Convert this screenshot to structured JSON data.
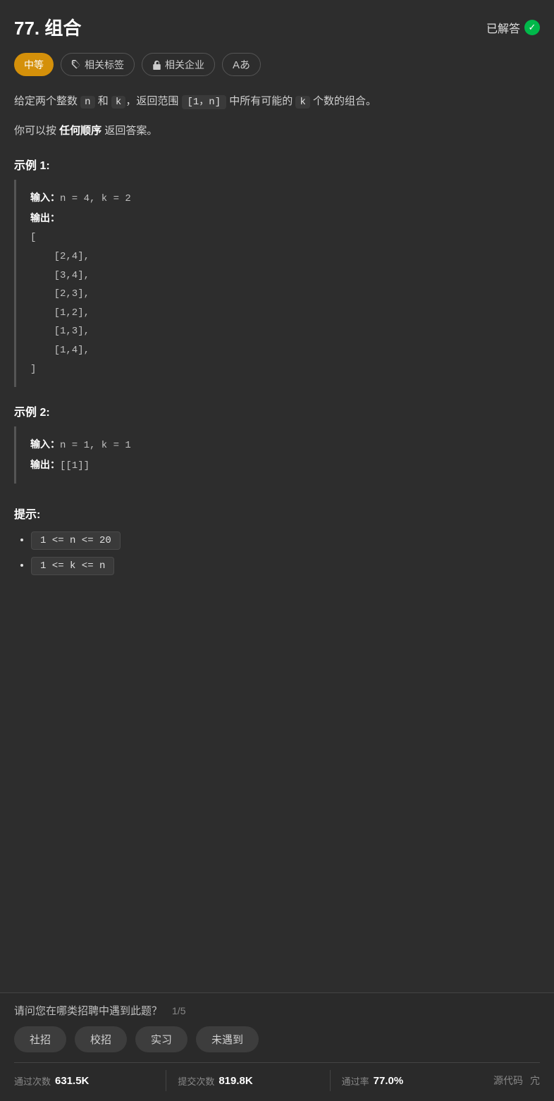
{
  "header": {
    "problem_number": "77.",
    "problem_title": "组合",
    "solved_label": "已解答"
  },
  "tags": [
    {
      "label": "中等",
      "type": "medium"
    },
    {
      "label": "相关标签",
      "type": "outline",
      "icon": "tag"
    },
    {
      "label": "相关企业",
      "type": "lock",
      "icon": "lock"
    },
    {
      "label": "Aあ",
      "type": "font"
    }
  ],
  "description": {
    "line1_prefix": "给定两个整数",
    "n_code": "n",
    "and_text": "和",
    "k_code": "k",
    "comma_text": "，返回范围",
    "range_bracket": "[1，n]",
    "suffix": "中所有可能的",
    "k_code2": "k",
    "end_text": "个数的组合。",
    "line2": "你可以按",
    "bold_text": "任何顺序",
    "line2_end": "返回答案。"
  },
  "examples": [
    {
      "title": "示例 1:",
      "input_label": "输入：",
      "input_value": "n = 4, k = 2",
      "output_label": "输出：",
      "output_value": "[\n    [2,4],\n    [3,4],\n    [2,3],\n    [1,2],\n    [1,3],\n    [1,4],\n]"
    },
    {
      "title": "示例 2:",
      "input_label": "输入：",
      "input_value": "n = 1, k = 1",
      "output_label": "输出：",
      "output_value": "[[1]]"
    }
  ],
  "hints": {
    "title": "提示:",
    "items": [
      "1 <= n <= 20",
      "1 <= k <= n"
    ]
  },
  "recruitment": {
    "question": "请问您在哪类招聘中遇到此题？",
    "page": "1/5",
    "buttons": [
      "社招",
      "校招",
      "实习",
      "未遇到"
    ]
  },
  "stats": {
    "pass_count_label": "通过次数",
    "pass_count_value": "631.5K",
    "submit_count_label": "提交次数",
    "submit_count_value": "819.8K",
    "pass_rate_label": "通过率",
    "pass_rate_value": "77.0%",
    "source_code": "源代码",
    "close": "宂"
  }
}
